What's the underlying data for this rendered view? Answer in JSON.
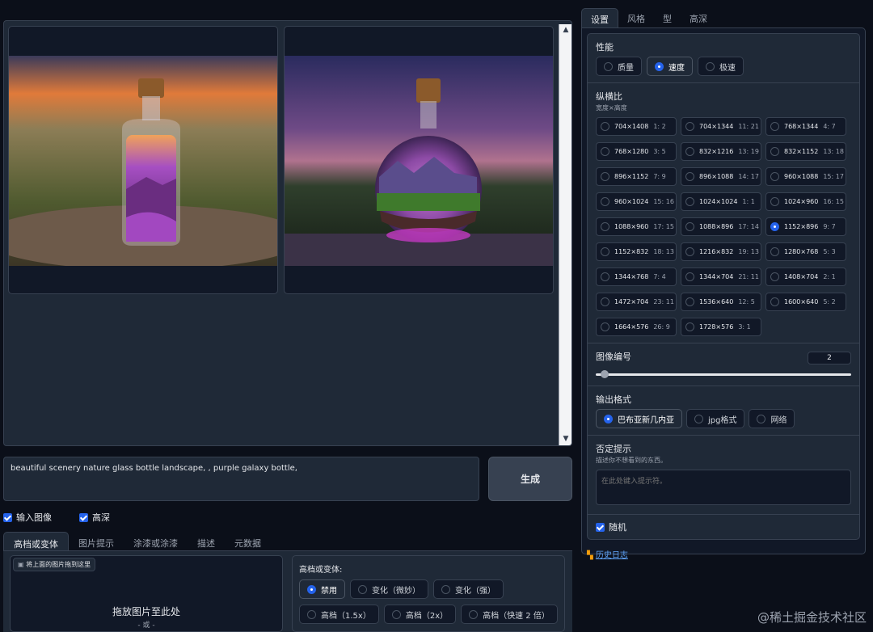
{
  "gallery": {
    "image_alts": [
      "glass bottle sunset landscape",
      "glass bottle galaxy landscape"
    ]
  },
  "prompt": {
    "text": "beautiful scenery nature glass bottle landscape, , purple galaxy bottle,"
  },
  "generate_label": "生成",
  "checks": [
    {
      "label": "输入图像"
    },
    {
      "label": "高深"
    }
  ],
  "input_tabs": [
    "高档或变体",
    "图片提示",
    "涂漆或涂漆",
    "描述",
    "元数据"
  ],
  "drop": {
    "hint": "将上面的图片拖到这里",
    "main": "拖放图片至此处",
    "or": "- 或 -"
  },
  "upscale": {
    "title": "高档或变体:",
    "options": [
      "禁用",
      "变化（微妙）",
      "变化（强）",
      "高档（1.5x）",
      "高档（2x）",
      "高档（快速 2 倍）"
    ]
  },
  "right_tabs": [
    "设置",
    "风格",
    "型",
    "高深"
  ],
  "performance": {
    "title": "性能",
    "options": [
      "质量",
      "速度",
      "极速"
    ],
    "selected": "速度"
  },
  "aspect": {
    "title": "纵横比",
    "info": "宽度×高度",
    "selected": "1152×896",
    "options": [
      {
        "size": "704×1408",
        "ratio": "1: 2"
      },
      {
        "size": "704×1344",
        "ratio": "11: 21"
      },
      {
        "size": "768×1344",
        "ratio": "4: 7"
      },
      {
        "size": "768×1280",
        "ratio": "3: 5"
      },
      {
        "size": "832×1216",
        "ratio": "13: 19"
      },
      {
        "size": "832×1152",
        "ratio": "13: 18"
      },
      {
        "size": "896×1152",
        "ratio": "7: 9"
      },
      {
        "size": "896×1088",
        "ratio": "14: 17"
      },
      {
        "size": "960×1088",
        "ratio": "15: 17"
      },
      {
        "size": "960×1024",
        "ratio": "15: 16"
      },
      {
        "size": "1024×1024",
        "ratio": "1: 1"
      },
      {
        "size": "1024×960",
        "ratio": "16: 15"
      },
      {
        "size": "1088×960",
        "ratio": "17: 15"
      },
      {
        "size": "1088×896",
        "ratio": "17: 14"
      },
      {
        "size": "1152×896",
        "ratio": "9: 7"
      },
      {
        "size": "1152×832",
        "ratio": "18: 13"
      },
      {
        "size": "1216×832",
        "ratio": "19: 13"
      },
      {
        "size": "1280×768",
        "ratio": "5: 3"
      },
      {
        "size": "1344×768",
        "ratio": "7: 4"
      },
      {
        "size": "1344×704",
        "ratio": "21: 11"
      },
      {
        "size": "1408×704",
        "ratio": "2: 1"
      },
      {
        "size": "1472×704",
        "ratio": "23: 11"
      },
      {
        "size": "1536×640",
        "ratio": "12: 5"
      },
      {
        "size": "1600×640",
        "ratio": "5: 2"
      },
      {
        "size": "1664×576",
        "ratio": "26: 9"
      },
      {
        "size": "1728×576",
        "ratio": "3: 1"
      }
    ]
  },
  "image_number": {
    "title": "图像编号",
    "value": "2"
  },
  "output_format": {
    "title": "输出格式",
    "options": [
      "巴布亚新几内亚",
      "jpg格式",
      "网络"
    ],
    "selected": "巴布亚新几内亚"
  },
  "negative": {
    "title": "否定提示",
    "info": "描述你不想看到的东西。",
    "placeholder": "在此处键入提示符。"
  },
  "random": {
    "label": "随机"
  },
  "history": {
    "label": "历史日志"
  },
  "watermark": "@稀土掘金技术社区",
  "colors": {
    "accent": "#2563eb",
    "bg": "#0b0f19",
    "panel": "#1f2937"
  }
}
